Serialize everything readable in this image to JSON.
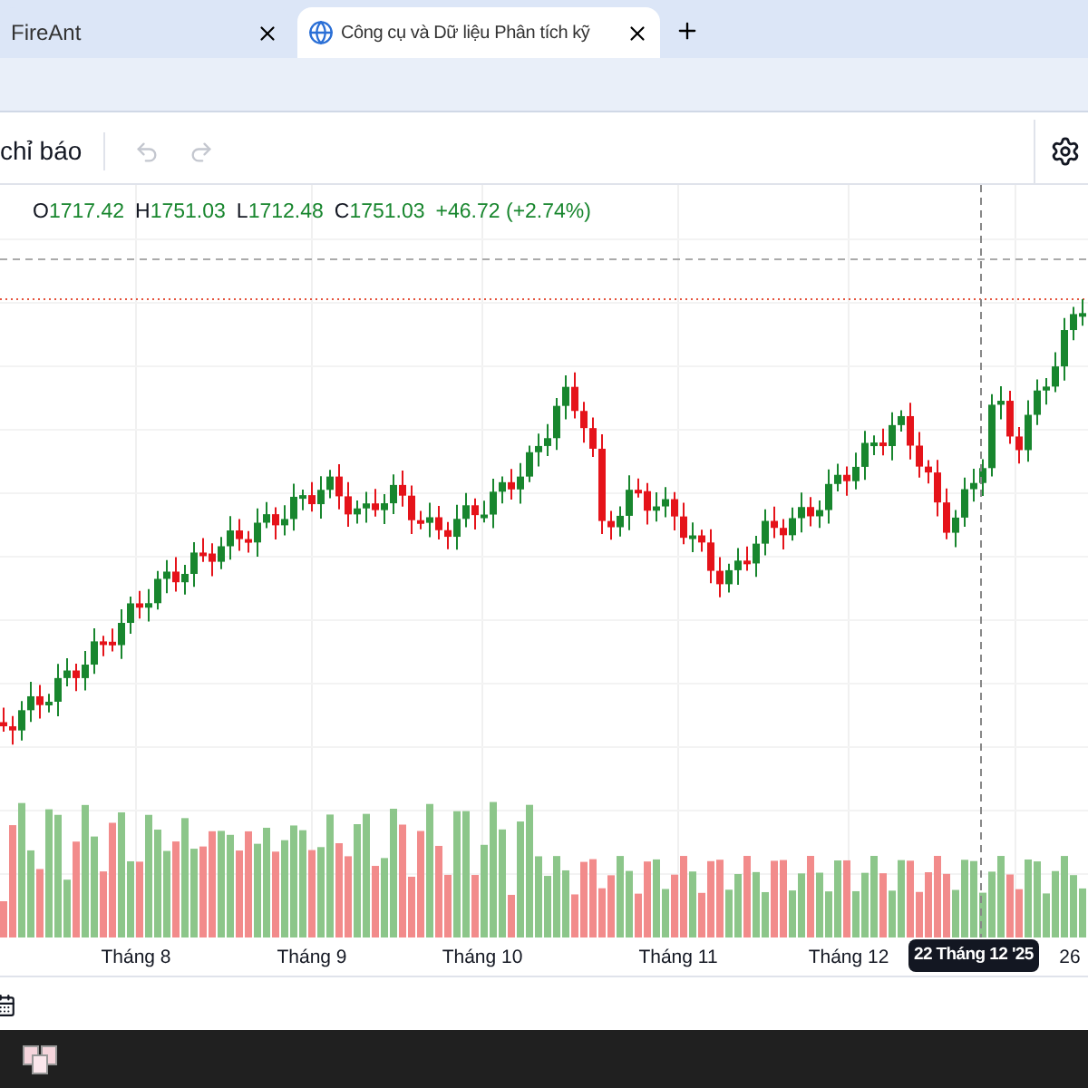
{
  "browser_tabs": [
    {
      "title": "FireAnt",
      "selected": false
    },
    {
      "title": "Công cụ và Dữ liệu Phân tích kỹ",
      "selected": true
    }
  ],
  "toolbar": {
    "indicators_label": "chỉ báo",
    "history_buttons": [
      {
        "kind": "undo",
        "disabled": true
      },
      {
        "kind": "redo",
        "disabled": true
      }
    ]
  },
  "legend": [
    {
      "key": "O",
      "value": "1717.42"
    },
    {
      "key": "H",
      "value": "1751.03"
    },
    {
      "key": "L",
      "value": "1712.48"
    },
    {
      "key": "C",
      "value": "1751.03"
    }
  ],
  "legend_change": "+46.72 (+2.74%)",
  "x_axis_labels": [
    "Tháng 8",
    "Tháng 9",
    "Tháng 10",
    "Tháng 11",
    "Tháng 12",
    "26"
  ],
  "crosshair_label": "22 Tháng 12 '25"
}
